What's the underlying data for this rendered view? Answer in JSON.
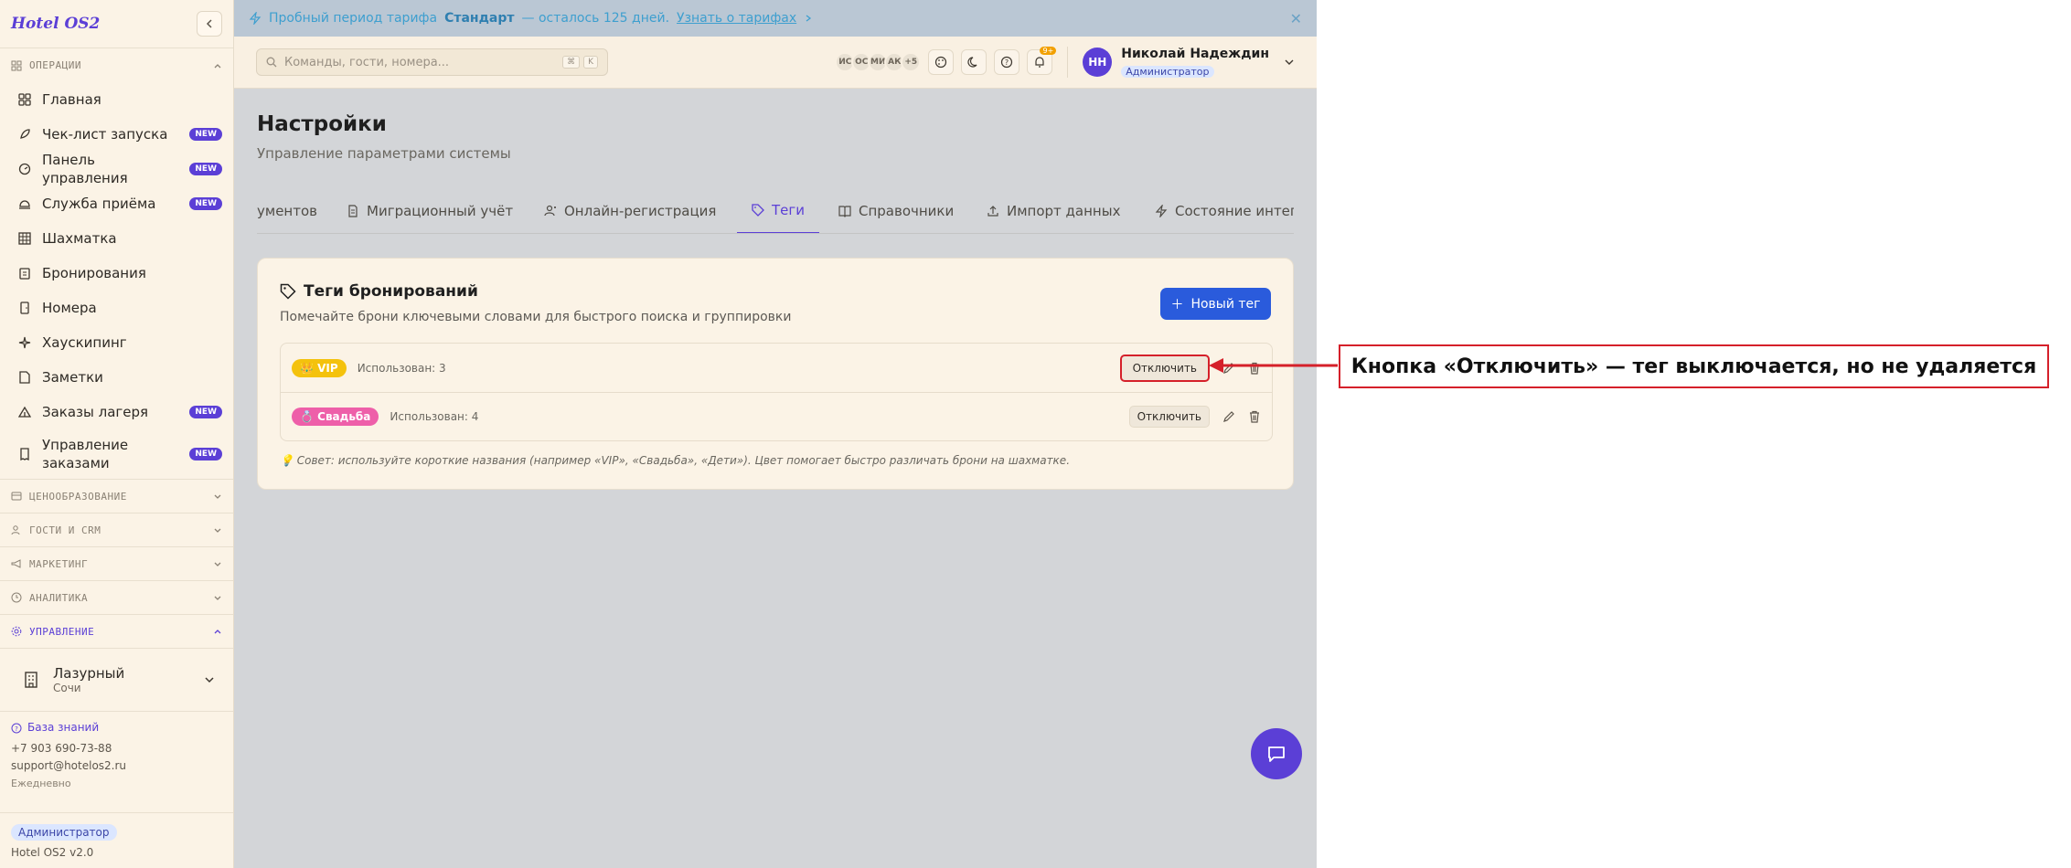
{
  "sidebar": {
    "logo": "Hotel OS2",
    "sections": {
      "operations": "ОПЕРАЦИИ",
      "pricing": "ЦЕНООБРАЗОВАНИЕ",
      "guests": "ГОСТИ И CRM",
      "marketing": "МАРКЕТИНГ",
      "analytics": "АНАЛИТИКА",
      "management": "УПРАВЛЕНИЕ"
    },
    "items": [
      {
        "label": "Главная",
        "icon": "grid-icon"
      },
      {
        "label": "Чек-лист запуска",
        "icon": "rocket-icon",
        "badge": "NEW"
      },
      {
        "label": "Панель управления",
        "icon": "gauge-icon",
        "badge": "NEW"
      },
      {
        "label": "Служба приёма",
        "icon": "bell-desk-icon",
        "badge": "NEW"
      },
      {
        "label": "Шахматка",
        "icon": "table-icon"
      },
      {
        "label": "Бронирования",
        "icon": "clipboard-icon"
      },
      {
        "label": "Номера",
        "icon": "door-icon"
      },
      {
        "label": "Хаускипинг",
        "icon": "sparkle-icon"
      },
      {
        "label": "Заметки",
        "icon": "note-icon"
      },
      {
        "label": "Заказы лагеря",
        "icon": "tent-icon",
        "badge": "NEW"
      },
      {
        "label": "Управление заказами",
        "icon": "receipt-icon",
        "badge": "NEW"
      }
    ],
    "hotel": {
      "name": "Лазурный",
      "city": "Сочи"
    },
    "support": {
      "kb": "База знаний",
      "phone": "+7 903 690-73-88",
      "email": "support@hotelos2.ru",
      "hours": "Ежедневно"
    },
    "footer": {
      "role": "Администратор",
      "version": "Hotel OS2 v2.0"
    }
  },
  "banner": {
    "prefix": "Пробный период тарифа",
    "plan": "Стандарт",
    "suffix": "— осталось 125 дней.",
    "link": "Узнать о тарифах"
  },
  "topbar": {
    "search_placeholder": "Команды, гости, номера...",
    "kbd": [
      "⌘",
      "K"
    ],
    "avatars": [
      "ИС",
      "ОС",
      "МИ",
      "АК",
      "+5"
    ],
    "notif_count": "9+",
    "user": {
      "initials": "НН",
      "name": "Николай Надеждин",
      "role": "Администратор"
    }
  },
  "page": {
    "title": "Настройки",
    "subtitle": "Управление параметрами системы",
    "tabs": [
      {
        "label": "ументов",
        "icon": ""
      },
      {
        "label": "Миграционный учёт",
        "icon": "doc-icon"
      },
      {
        "label": "Онлайн-регистрация",
        "icon": "user-plus-icon"
      },
      {
        "label": "Теги",
        "icon": "tag-icon",
        "active": true
      },
      {
        "label": "Справочники",
        "icon": "book-icon"
      },
      {
        "label": "Импорт данных",
        "icon": "upload-icon"
      },
      {
        "label": "Состояние интег",
        "icon": "bolt-icon"
      }
    ]
  },
  "card": {
    "title": "Теги бронирований",
    "subtitle": "Помечайте брони ключевыми словами для быстрого поиска и группировки",
    "new_button": "Новый тег",
    "tags": [
      {
        "emoji": "👑",
        "name": "VIP",
        "usage": "Использован: 3",
        "disable": "Отключить",
        "color": "#f4c20d"
      },
      {
        "emoji": "💍",
        "name": "Свадьба",
        "usage": "Использован: 4",
        "disable": "Отключить",
        "color": "#ee5fa9"
      }
    ],
    "tip": "💡 Совет: используйте короткие названия (например «VIP», «Свадьба», «Дети»). Цвет помогает быстро различать брони на шахматке."
  },
  "annotation": {
    "text": "Кнопка «Отключить» — тег выключается, но не удаляется"
  }
}
